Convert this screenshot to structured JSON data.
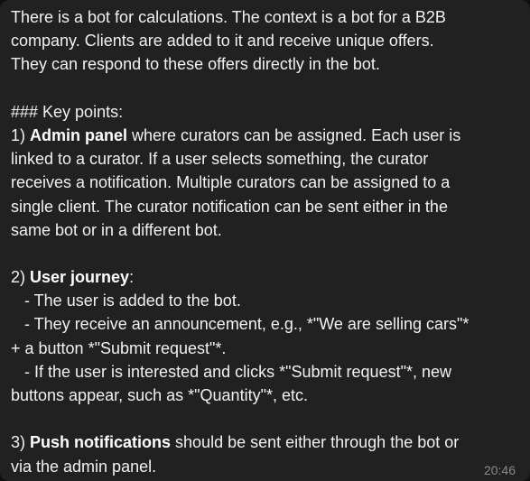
{
  "message": {
    "p1": {
      "l1": "There is a bot for calculations. The context is a bot for a B2B",
      "l2": "company. Clients are added to it and receive unique offers.",
      "l3": "They can respond to these offers directly in the bot."
    },
    "heading": "### Key points:",
    "p2": {
      "num": "1) ",
      "bold": "Admin panel",
      "l1_rest": " where curators can be assigned. Each user is",
      "l2": "linked to a curator. If a user selects something, the curator",
      "l3": "receives a notification. Multiple curators can be assigned to a",
      "l4": "single client. The curator notification can be sent either in the",
      "l5": "same bot or in a different bot."
    },
    "p3": {
      "num": "2) ",
      "bold": "User journey",
      "colon": ":",
      "b1": "   - The user is added to the bot.",
      "b2": "   - They receive an announcement, e.g., *\"We are selling cars\"*",
      "b2_cont": "+ a button *\"Submit request\"*.",
      "b3": "   - If the user is interested and clicks *\"Submit request\"*, new",
      "b3_cont": "buttons appear, such as *\"Quantity\"*, etc."
    },
    "p4": {
      "num": "3) ",
      "bold": "Push notifications",
      "l1_rest": " should be sent either through the bot or",
      "l2": "via the admin panel."
    },
    "time": "20:46"
  },
  "colors": {
    "bubble_bg": "#212121",
    "text": "#f1f1f1",
    "time_text": "#8a8a8a"
  }
}
